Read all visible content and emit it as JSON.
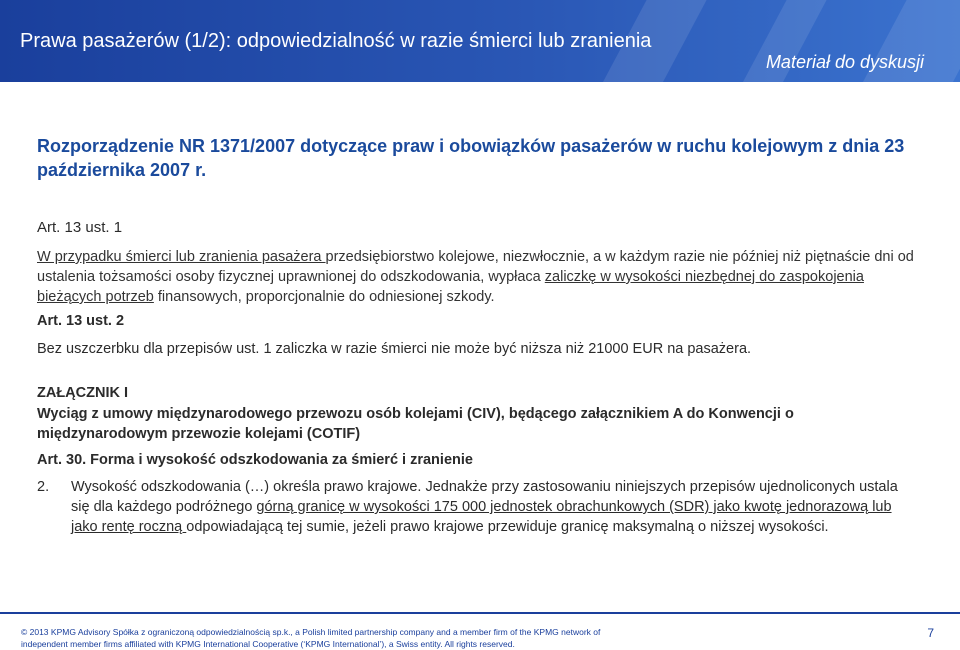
{
  "header": {
    "title": "Prawa pasażerów (1/2): odpowiedzialność w razie śmierci lub zranienia",
    "tag": "Materiał do dyskusji",
    "brand_color": "#1a3f9c"
  },
  "regulation_title": "Rozporządzenie NR 1371/2007 dotyczące praw i obowiązków pasażerów w ruchu kolejowym z dnia 23 października 2007 r.",
  "article_13_1": {
    "heading": "Art. 13 ust. 1",
    "text_underlined_1": "W przypadku śmierci lub zranienia pasażera ",
    "text_1": "przedsiębiorstwo kolejowe, niezwłocznie, a w każdym razie nie później niż piętnaście dni od ustalenia tożsamości osoby fizycznej uprawnionej do odszkodowania, wypłaca ",
    "text_underlined_2": "zaliczkę w wysokości niezbędnej do zaspokojenia bieżących potrzeb",
    "text_2": " finansowych, proporcjonalnie do odniesionej szkody."
  },
  "article_13_2": {
    "heading": "Art. 13 ust. 2",
    "text": "Bez uszczerbku dla przepisów ust. 1 zaliczka w razie śmierci nie może być niższa niż 21000 EUR na pasażera."
  },
  "annex": {
    "heading": "ZAŁĄCZNIK I",
    "description": "Wyciąg z umowy międzynarodowego przewozu osób kolejami (CIV), będącego załącznikiem A do Konwencji o międzynarodowym przewozie kolejami (COTIF)",
    "article_30": "Art. 30. Forma i wysokość odszkodowania za śmierć i zranienie",
    "point_number": "2.",
    "point_text_1": "Wysokość odszkodowania (…) określa prawo krajowe. Jednakże przy zastosowaniu niniejszych przepisów ujednoliconych ustala się dla każdego podróżnego ",
    "point_underlined": "górną granicę w wysokości 175 000 jednostek obrachunkowych (SDR) jako kwotę jednorazową lub jako rentę roczną ",
    "point_text_2": "odpowiadającą tej sumie, jeżeli prawo krajowe przewiduje granicę maksymalną o niższej wysokości."
  },
  "footer": {
    "line1": "© 2013 KPMG Advisory Spółka z ograniczoną odpowiedzialnością sp.k., a Polish limited partnership company and a member firm of the KPMG network of",
    "line2": "independent member firms affiliated with KPMG International Cooperative (‘KPMG International’), a Swiss entity. All rights reserved.",
    "page_number": "7"
  }
}
